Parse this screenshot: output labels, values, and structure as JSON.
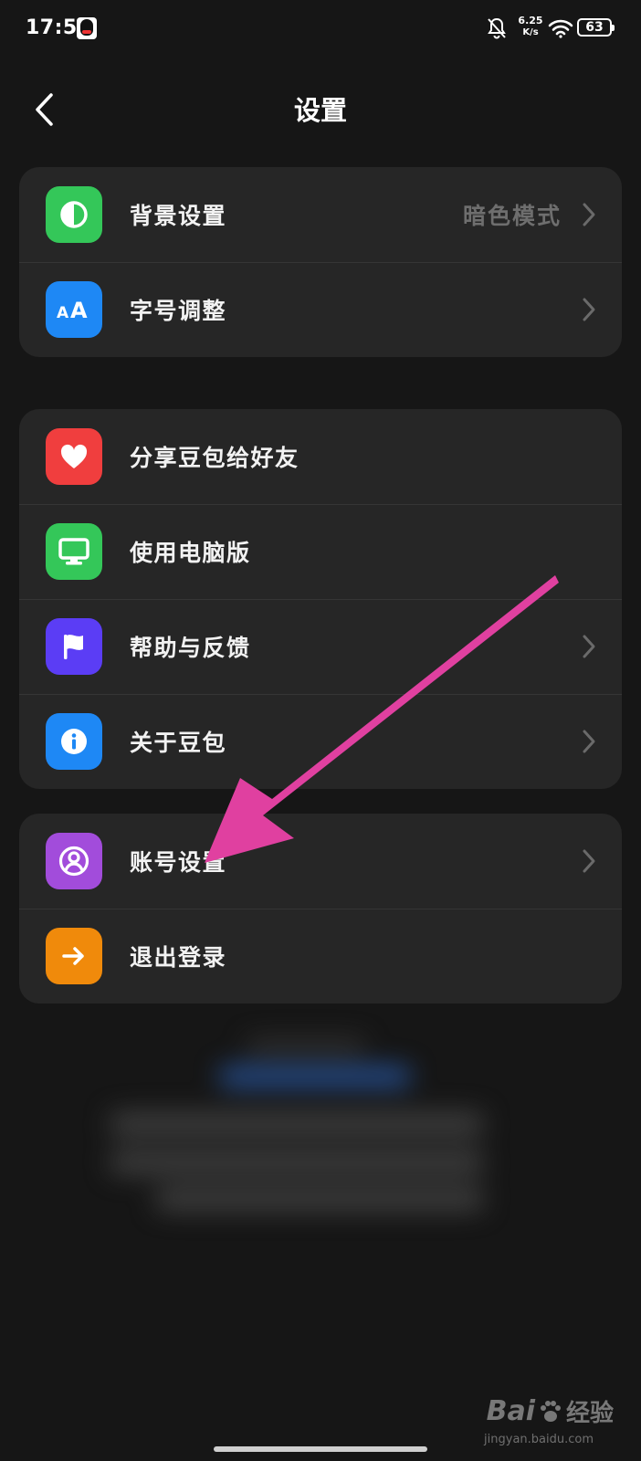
{
  "status_bar": {
    "time": "17:59",
    "network_speed_value": "6.25",
    "network_speed_unit": "K/s",
    "battery": "63"
  },
  "nav": {
    "title": "设置"
  },
  "groups": [
    {
      "items": [
        {
          "label": "背景设置",
          "value": "暗色模式",
          "icon": "half-circle-icon",
          "color": "#34C759",
          "chevron": true
        },
        {
          "label": "字号调整",
          "value": "",
          "icon": "font-size-icon",
          "color": "#1E88F5",
          "chevron": true
        }
      ]
    },
    {
      "items": [
        {
          "label": "分享豆包给好友",
          "icon": "heart-icon",
          "color": "#F03E3E",
          "chevron": false
        },
        {
          "label": "使用电脑版",
          "icon": "monitor-icon",
          "color": "#34C759",
          "chevron": false
        },
        {
          "label": "帮助与反馈",
          "icon": "flag-icon",
          "color": "#5B3DF5",
          "chevron": true
        },
        {
          "label": "关于豆包",
          "icon": "info-icon",
          "color": "#1E88F5",
          "chevron": true
        }
      ]
    },
    {
      "items": [
        {
          "label": "账号设置",
          "icon": "user-icon",
          "color": "#A24CDB",
          "chevron": true
        },
        {
          "label": "退出登录",
          "icon": "logout-arrow-icon",
          "color": "#F08A0B",
          "chevron": false
        }
      ]
    }
  ],
  "annotation_arrow_color": "#E040A0",
  "watermark": {
    "logo": "Bai",
    "text": "经验",
    "url": "jingyan.baidu.com"
  }
}
